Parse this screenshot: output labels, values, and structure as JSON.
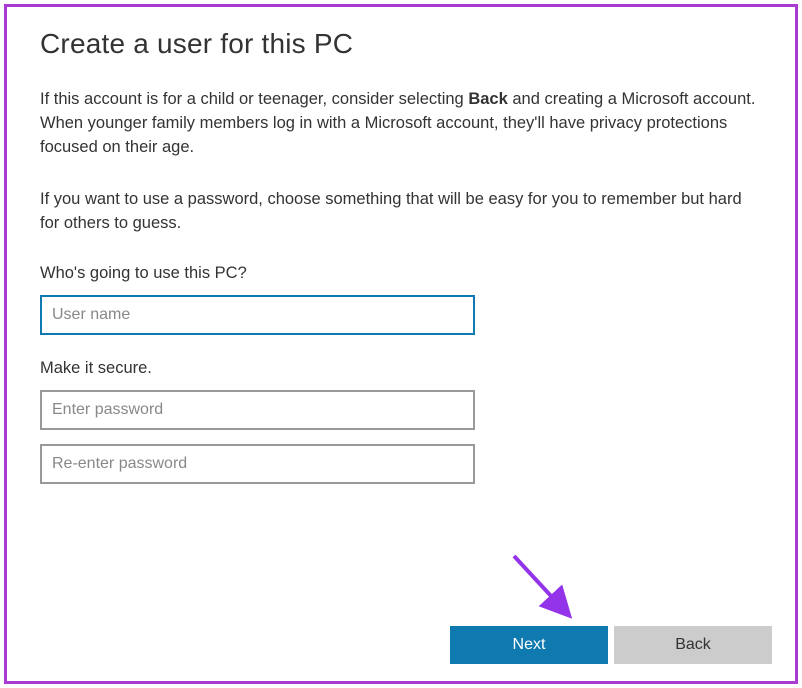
{
  "title": "Create a user for this PC",
  "description1_pre": "If this account is for a child or teenager, consider selecting ",
  "description1_bold": "Back",
  "description1_post": " and creating a Microsoft account. When younger family members log in with a Microsoft account, they'll have privacy protections focused on their age.",
  "description2": "If you want to use a password, choose something that will be easy for you to remember but hard for others to guess.",
  "username_section_label": "Who's going to use this PC?",
  "username_placeholder": "User name",
  "username_value": "",
  "password_section_label": "Make it secure.",
  "password_placeholder": "Enter password",
  "password_value": "",
  "password_confirm_placeholder": "Re-enter password",
  "password_confirm_value": "",
  "buttons": {
    "next": "Next",
    "back": "Back"
  },
  "colors": {
    "accent": "#0f7ab0",
    "border": "#a93bd4",
    "arrow": "#9333ea"
  }
}
